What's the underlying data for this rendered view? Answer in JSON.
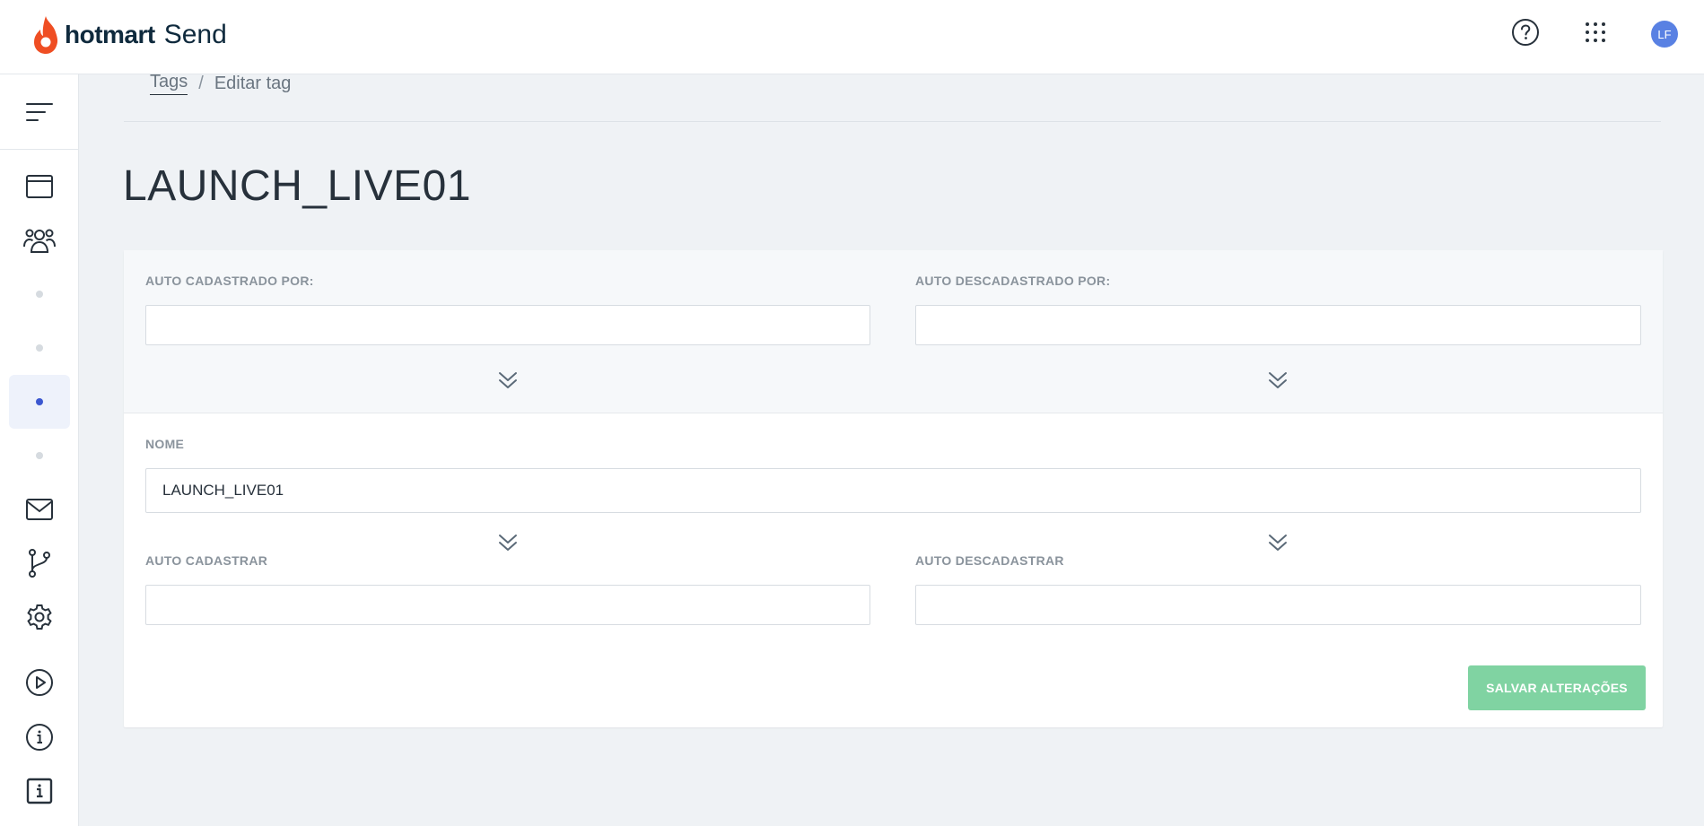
{
  "header": {
    "brand_name": "hotmart",
    "product_name": "Send",
    "avatar_initials": "LF",
    "icons": [
      "help-icon",
      "apps-grid-icon"
    ],
    "brand_color": "#ef4e23"
  },
  "sidebar": {
    "items": [
      {
        "icon": "menu-icon"
      },
      {
        "icon": "browser-window-icon"
      },
      {
        "icon": "users-icon"
      },
      {
        "icon": "dot"
      },
      {
        "icon": "dot"
      },
      {
        "icon": "dot",
        "active": true
      },
      {
        "icon": "dot"
      },
      {
        "icon": "mail-icon"
      },
      {
        "icon": "flow-branch-icon"
      },
      {
        "icon": "gear-icon"
      },
      {
        "icon": "play-circle-icon"
      },
      {
        "icon": "info-circle-icon"
      },
      {
        "icon": "info-square-icon"
      }
    ]
  },
  "breadcrumb": {
    "link": "Tags",
    "separator": "/",
    "current": "Editar tag"
  },
  "page": {
    "title": "LAUNCH_LIVE01"
  },
  "form": {
    "auto_cadastrado_por_label": "AUTO CADASTRADO POR:",
    "auto_cadastrado_por_value": "",
    "auto_descadastrado_por_label": "AUTO DESCADASTRADO POR:",
    "auto_descadastrado_por_value": "",
    "nome_label": "NOME",
    "nome_value": "LAUNCH_LIVE01",
    "auto_cadastrar_label": "AUTO CADASTRAR",
    "auto_cadastrar_value": "",
    "auto_descadastrar_label": "AUTO DESCADASTRAR",
    "auto_descadastrar_value": "",
    "save_label": "SALVAR ALTERAÇÕES"
  },
  "colors": {
    "accent_green": "#80d3a2",
    "active_blue": "#3b57d0",
    "avatar_blue": "#5981e3"
  }
}
